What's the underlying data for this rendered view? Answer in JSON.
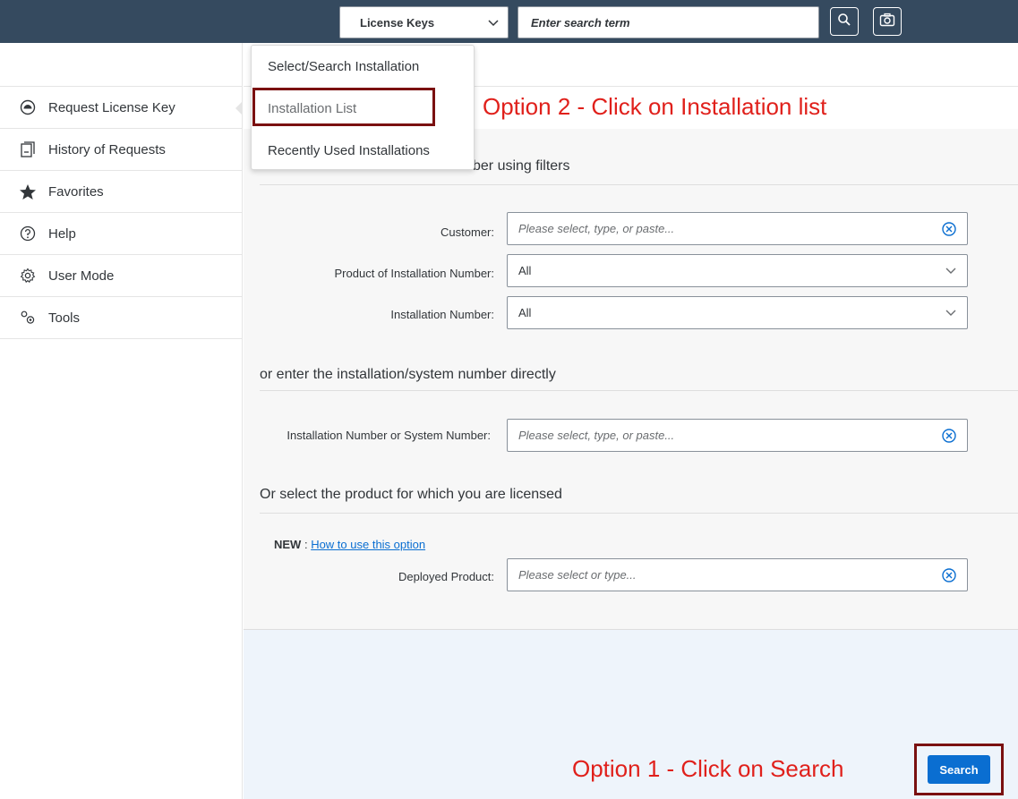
{
  "shellbar": {
    "scope_label": "License Keys",
    "search_placeholder": "Enter search term"
  },
  "sidebar": {
    "items": [
      {
        "label": "Request License Key",
        "icon": "license-key-icon"
      },
      {
        "label": "History of Requests",
        "icon": "history-icon"
      },
      {
        "label": "Favorites",
        "icon": "star-icon"
      },
      {
        "label": "Help",
        "icon": "help-icon"
      },
      {
        "label": "User Mode",
        "icon": "gear-icon"
      },
      {
        "label": "Tools",
        "icon": "tools-icon"
      }
    ]
  },
  "dropdown": {
    "items": [
      {
        "label": "Select/Search Installation"
      },
      {
        "label": "Installation List"
      },
      {
        "label": "Recently Used Installations"
      }
    ]
  },
  "annotations": {
    "option2": "Option 2 - Click on Installation list",
    "option1": "Option 1 - Click on Search"
  },
  "filters": {
    "section_title_visible": "ber using filters",
    "customer_label": "Customer:",
    "customer_placeholder": "Please select, type, or paste...",
    "product_label": "Product of Installation Number:",
    "product_value": "All",
    "installation_label": "Installation Number:",
    "installation_value": "All"
  },
  "direct": {
    "section_title": "or enter the installation/system number directly",
    "label": "Installation Number or System Number:",
    "placeholder": "Please select, type, or paste..."
  },
  "product": {
    "section_title": "Or select the product for which you are licensed",
    "new_prefix": "NEW",
    "new_separator": " : ",
    "new_link": "How to use this option",
    "deployed_label": "Deployed Product:",
    "deployed_placeholder": "Please select or type..."
  },
  "actions": {
    "search_label": "Search"
  }
}
